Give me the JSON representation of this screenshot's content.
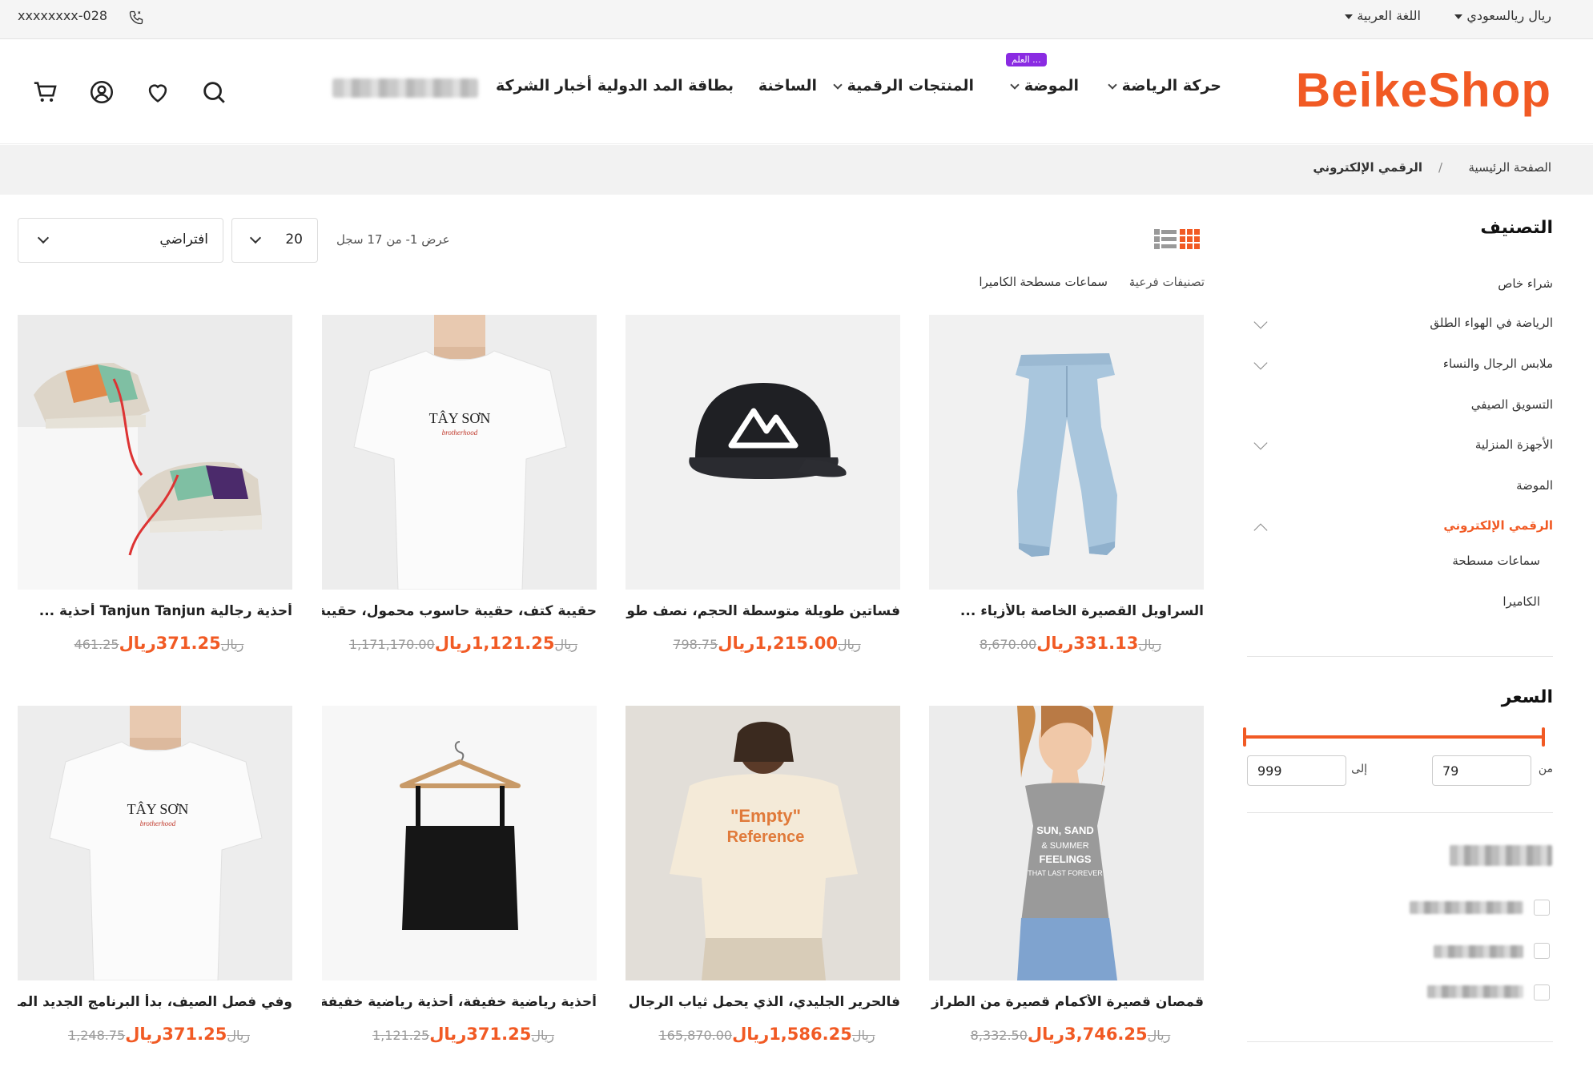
{
  "topbar": {
    "phone": "xxxxxxxx-028",
    "currency": "ريال ريالسعودي",
    "language": "اللغة العربية"
  },
  "header": {
    "logo": "BeikeShop",
    "nav": [
      "حركة الرياضة",
      "الموضة",
      "المنتجات الرقمية",
      "الساخنة",
      "بطاقة المد الدولية",
      "أخبار الشركة"
    ],
    "badge": "العلم ..."
  },
  "breadcrumb": {
    "home": "الصفحة الرئيسية",
    "separator": "/",
    "current": "الرقمي الإلكتروني"
  },
  "sidebar": {
    "category_title": "التصنيف",
    "categories": [
      "شراء خاص",
      "الرياضة في الهواء الطلق",
      "ملابس الرجال والنساء",
      "التسويق الصيفي",
      "الأجهزة المنزلية",
      "الموضة",
      "الرقمي الإلكتروني",
      "سماعات مسطحة",
      "الكاميرا"
    ],
    "price_title": "السعر",
    "price_from_label": "من",
    "price_to_label": "إلى",
    "price_from": "79",
    "price_to": "999"
  },
  "toolbar": {
    "count_text": "عرض 1- من 17 سجل",
    "per_page": "20",
    "sort": "افتراضي",
    "subcat_label": "تصنيفات فرعية",
    "subcat_colon": ":",
    "subcats": [
      "سماعات مسطحة",
      "الكاميرا"
    ]
  },
  "products": [
    {
      "name": "السراويل القصيرة الخاصة بالأزياء ...",
      "price": "331.13ريال",
      "old": "8,670.00ريال"
    },
    {
      "name": "فساتين طويلة متوسطة الحجم، نصف طويلة...",
      "price": "1,215.00ريال",
      "old": "798.75ريال"
    },
    {
      "name": "حقيبة كتف، حقيبة حاسوب محمول، حقيبة ...",
      "price": "1,121.25ريال",
      "old": "1,171,170.00ريال"
    },
    {
      "name": "أحذية رجالية Tanjun Tanjun أحذية ...",
      "price": "371.25ريال",
      "old": "461.25ريال"
    },
    {
      "name": "قمصان قصيرة الأكمام قصيرة من الطراز الأ...",
      "price": "3,746.25ريال",
      "old": "8,332.50ريال"
    },
    {
      "name": "فالحرير الجليدي، الذي يحمل ثياب الرجال ذا...",
      "price": "1,586.25ريال",
      "old": "165,870.00ريال"
    },
    {
      "name": "أحذية رياضية خفيفة، أحذية رياضية خفيفة ...",
      "price": "371.25ريال",
      "old": "1,121.25ريال"
    },
    {
      "name": "وفي فصل الصيف، بدأ البرنامج الجديد المتمش...",
      "price": "371.25ريال",
      "old": "1,248.75ريال"
    }
  ],
  "colors": {
    "accent": "#f15a24",
    "badge": "#8a2be2"
  }
}
